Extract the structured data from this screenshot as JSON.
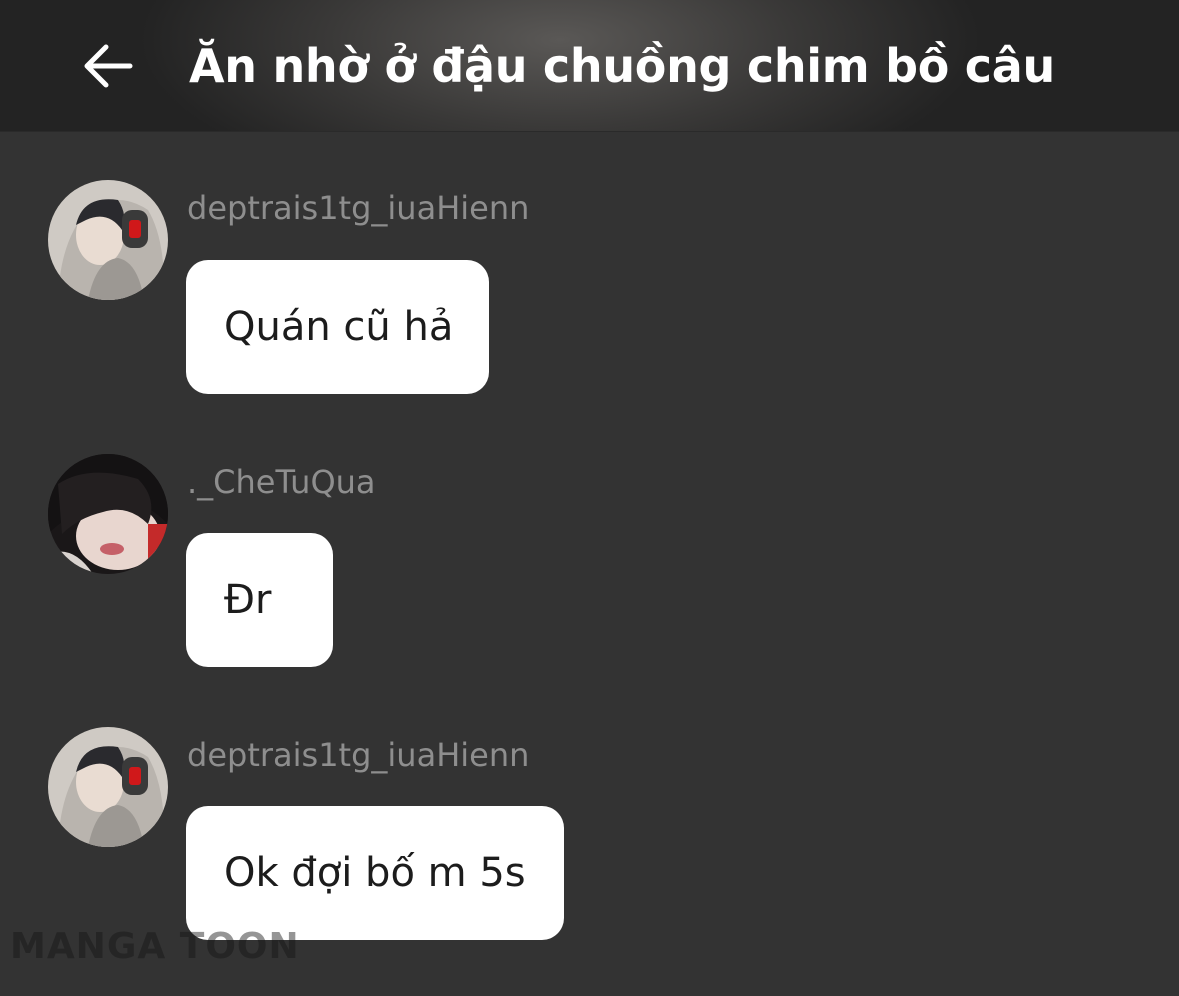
{
  "header": {
    "title": "Ăn nhờ ở đậu chuồng chim bồ câu",
    "back_icon": "arrow-left-icon"
  },
  "messages": [
    {
      "username": "deptrais1tg_iuaHienn",
      "text": "Quán cũ hả",
      "avatar": "avatar-headphones-hood"
    },
    {
      "username": "._CheTuQua",
      "text": "Đr",
      "avatar": "avatar-dark-hair"
    },
    {
      "username": "deptrais1tg_iuaHienn",
      "text": "Ok đợi bố m 5s",
      "avatar": "avatar-headphones-hood"
    }
  ],
  "watermark": "MANGA TOON",
  "colors": {
    "background": "#333333",
    "bubble": "#ffffff",
    "username": "#8e8e8e",
    "title": "#ffffff"
  }
}
